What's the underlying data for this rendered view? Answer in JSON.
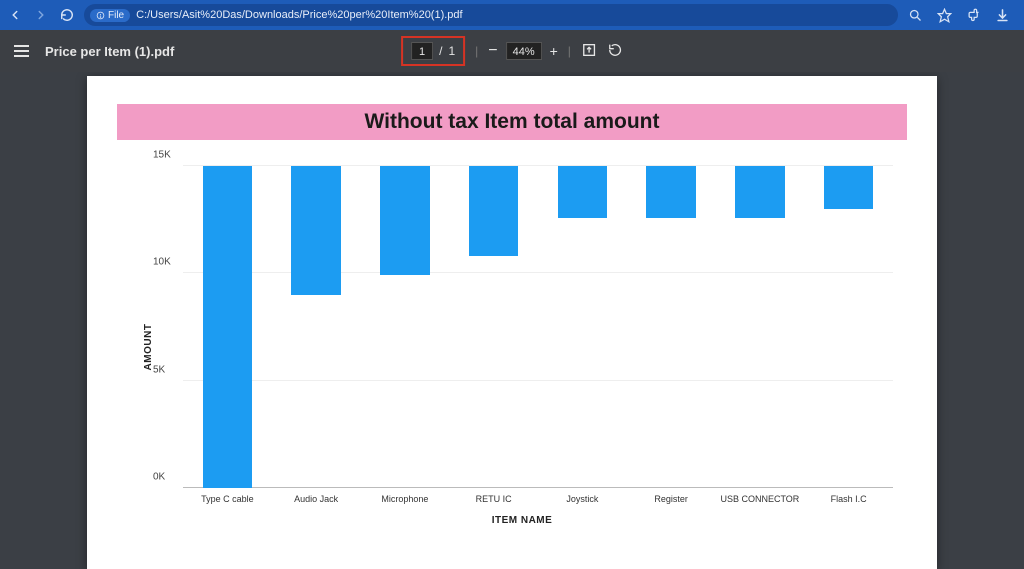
{
  "browser": {
    "url": "C:/Users/Asit%20Das/Downloads/Price%20per%20Item%20(1).pdf",
    "url_chip_label": "File"
  },
  "pdf_viewer": {
    "file_title": "Price per Item (1).pdf",
    "page_current": "1",
    "page_sep": "/",
    "page_total": "1",
    "zoom_minus": "−",
    "zoom_value": "44%",
    "zoom_plus": "+"
  },
  "chart_data": {
    "type": "bar",
    "title": "Without tax Item total amount",
    "xlabel": "ITEM NAME",
    "ylabel": "AMOUNT",
    "ylim": [
      0,
      15000
    ],
    "yticks": [
      0,
      5000,
      10000,
      15000
    ],
    "ytick_labels": [
      "0K",
      "5K",
      "10K",
      "15K"
    ],
    "categories": [
      "Type C cable",
      "Audio Jack",
      "Microphone",
      "RETU IC",
      "Joystick",
      "Register",
      "USB CONNECTOR",
      "Flash I.C"
    ],
    "values": [
      15000,
      6000,
      5100,
      4200,
      2400,
      2400,
      2400,
      2000
    ],
    "bar_color": "#1c9cf2",
    "title_bg": "#f29cc5"
  }
}
